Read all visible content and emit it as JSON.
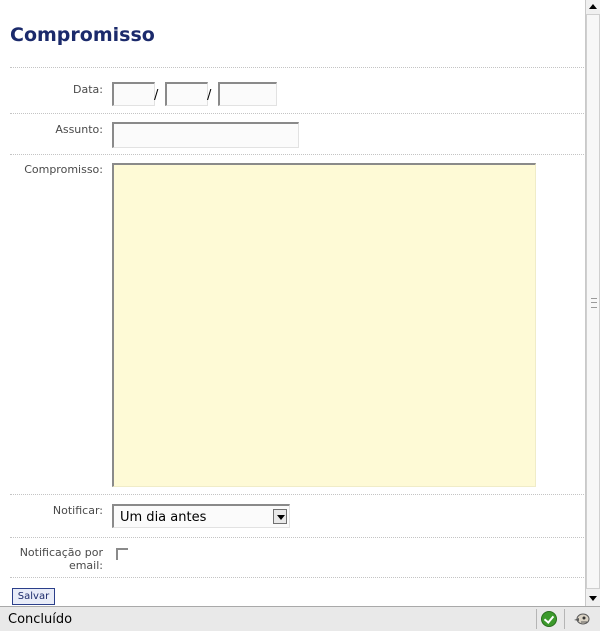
{
  "page": {
    "title": "Compromisso"
  },
  "form": {
    "date_label": "Data:",
    "date_separator": "/",
    "subject_label": "Assunto:",
    "appointment_label": "Compromisso:",
    "notify_label": "Notificar:",
    "notify_selected": "Um dia antes",
    "email_notification_label_line1": "Notificação por",
    "email_notification_label_line2": "email:",
    "email_notification_checked": false,
    "save_label": "Salvar"
  },
  "statusbar": {
    "text": "Concluído",
    "icons": [
      "check-icon",
      "connection-icon"
    ]
  },
  "colors": {
    "title": "#1b2a6b",
    "textarea_bg": "#fefad6"
  }
}
